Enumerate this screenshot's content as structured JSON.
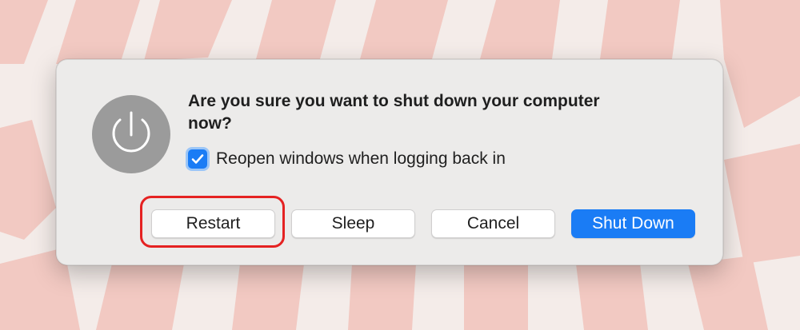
{
  "dialog": {
    "message": "Are you sure you want to shut down your computer now?",
    "icon": "power-icon",
    "reopen_checkbox": {
      "label": "Reopen windows when logging back in",
      "checked": true
    },
    "buttons": {
      "restart": "Restart",
      "sleep": "Sleep",
      "cancel": "Cancel",
      "shut_down": "Shut Down"
    }
  },
  "colors": {
    "accent": "#1a7cf5",
    "annotation": "#e52222",
    "icon_gray": "#9b9b9b"
  }
}
